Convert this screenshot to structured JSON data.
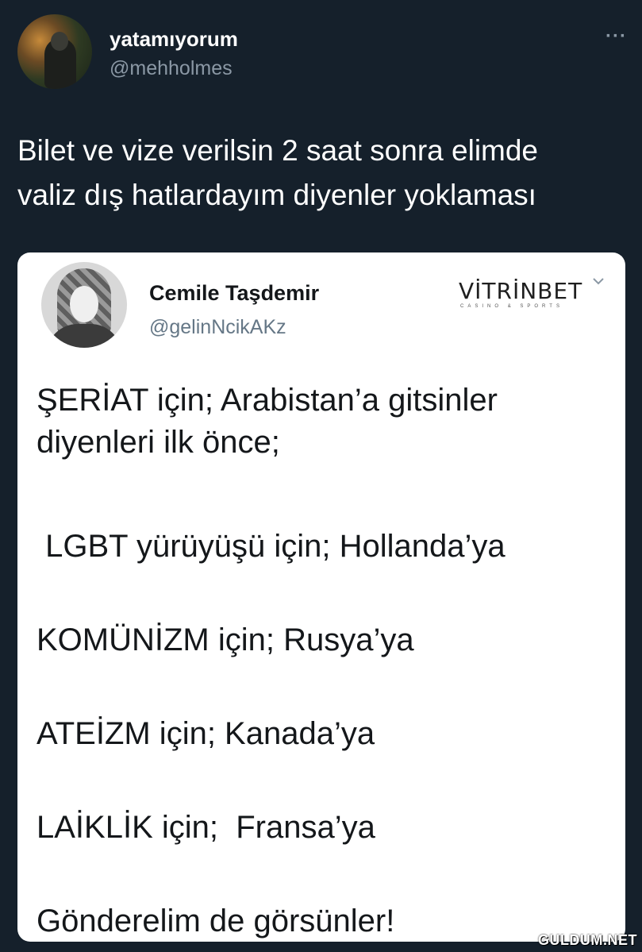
{
  "tweet": {
    "user": {
      "name": "yatamıyorum",
      "handle": "@mehholmes"
    },
    "more_label": "···",
    "text_lines": [
      "Bilet ve vize verilsin 2 saat sonra elimde",
      "valiz dış hatlardayım diyenler yoklaması"
    ]
  },
  "embed": {
    "user": {
      "name": "Cemile Taşdemir",
      "handle": "@gelinNcikAKz"
    },
    "brand": {
      "name": "VİTRİNBET",
      "tagline": "CASINO & SPORTS"
    },
    "text_lines": [
      "ŞERİAT için; Arabistan’a gitsinler",
      "diyenleri ilk önce;",
      " LGBT yürüyüşü için; Hollanda’ya",
      "KOMÜNİZM için; Rusya’ya",
      "ATEİZM için; Kanada’ya",
      "LAİKLİK için;  Fransa’ya",
      "Gönderelim de görsünler!"
    ]
  },
  "watermark": "GULDUM.NET",
  "colors": {
    "background": "#15202b",
    "card": "#ffffff",
    "secondary_text": "#8b98a5"
  },
  "icons": {
    "more": "more-dots-icon",
    "chevron": "chevron-down-icon"
  }
}
